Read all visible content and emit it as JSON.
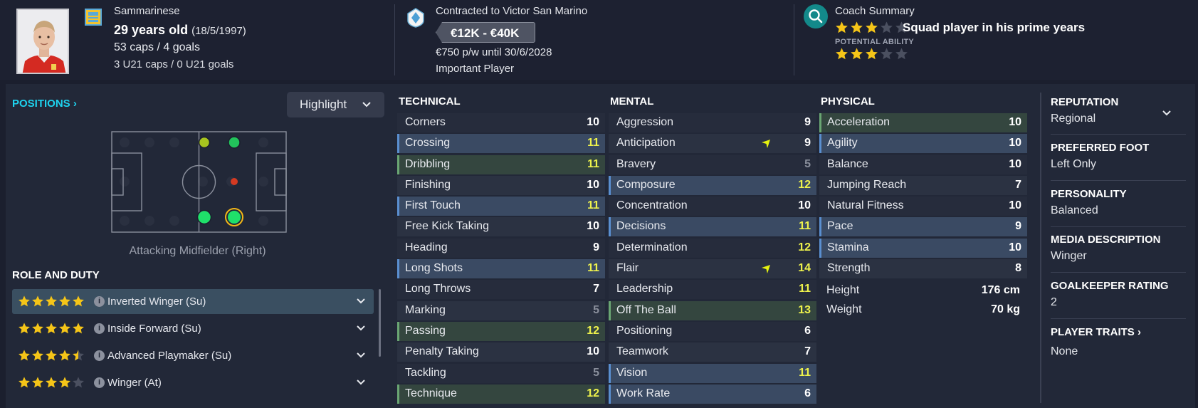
{
  "header": {
    "nationality": "Sammarinese",
    "age": "29 years old",
    "dob": "(18/5/1997)",
    "caps": "53 caps / 4 goals",
    "u21_caps": "3 U21 caps / 0 U21 goals",
    "contract": "Contracted to Victor San Marino",
    "wage_range": "€12K - €40K",
    "wage_detail": "€750 p/w until 30/6/2028",
    "squad_status": "Important Player",
    "coach_title": "Coach Summary",
    "current_ability_stars": 3,
    "coach_description": "Squad player in his prime years",
    "potential_label": "POTENTIAL ABILITY",
    "potential_ability_stars": 3
  },
  "positions": {
    "header": "POSITIONS",
    "highlight_label": "Highlight",
    "position_label": "Attacking Midfielder (Right)",
    "role_header": "ROLE AND DUTY",
    "roles": [
      {
        "name": "Inverted Winger (Su)",
        "stars": 5
      },
      {
        "name": "Inside Forward (Su)",
        "stars": 5
      },
      {
        "name": "Advanced Playmaker (Su)",
        "stars": 4.5
      },
      {
        "name": "Winger (At)",
        "stars": 4
      }
    ]
  },
  "technical": {
    "header": "TECHNICAL",
    "attributes": [
      {
        "name": "Corners",
        "value": "10",
        "hl": ""
      },
      {
        "name": "Crossing",
        "value": "11",
        "hl": "blue"
      },
      {
        "name": "Dribbling",
        "value": "11",
        "hl": "green"
      },
      {
        "name": "Finishing",
        "value": "10",
        "hl": ""
      },
      {
        "name": "First Touch",
        "value": "11",
        "hl": "blue"
      },
      {
        "name": "Free Kick Taking",
        "value": "10",
        "hl": ""
      },
      {
        "name": "Heading",
        "value": "9",
        "hl": ""
      },
      {
        "name": "Long Shots",
        "value": "11",
        "hl": "blue"
      },
      {
        "name": "Long Throws",
        "value": "7",
        "hl": ""
      },
      {
        "name": "Marking",
        "value": "5",
        "hl": ""
      },
      {
        "name": "Passing",
        "value": "12",
        "hl": "green"
      },
      {
        "name": "Penalty Taking",
        "value": "10",
        "hl": ""
      },
      {
        "name": "Tackling",
        "value": "5",
        "hl": ""
      },
      {
        "name": "Technique",
        "value": "12",
        "hl": "green"
      }
    ]
  },
  "mental": {
    "header": "MENTAL",
    "attributes": [
      {
        "name": "Aggression",
        "value": "9",
        "hl": ""
      },
      {
        "name": "Anticipation",
        "value": "9",
        "hl": "",
        "arrow": true
      },
      {
        "name": "Bravery",
        "value": "5",
        "hl": ""
      },
      {
        "name": "Composure",
        "value": "12",
        "hl": "blue"
      },
      {
        "name": "Concentration",
        "value": "10",
        "hl": ""
      },
      {
        "name": "Decisions",
        "value": "11",
        "hl": "blue"
      },
      {
        "name": "Determination",
        "value": "12",
        "hl": ""
      },
      {
        "name": "Flair",
        "value": "14",
        "hl": "",
        "arrow": true
      },
      {
        "name": "Leadership",
        "value": "11",
        "hl": ""
      },
      {
        "name": "Off The Ball",
        "value": "13",
        "hl": "green"
      },
      {
        "name": "Positioning",
        "value": "6",
        "hl": ""
      },
      {
        "name": "Teamwork",
        "value": "7",
        "hl": ""
      },
      {
        "name": "Vision",
        "value": "11",
        "hl": "blue"
      },
      {
        "name": "Work Rate",
        "value": "6",
        "hl": "blue"
      }
    ]
  },
  "physical": {
    "header": "PHYSICAL",
    "attributes": [
      {
        "name": "Acceleration",
        "value": "10",
        "hl": "green"
      },
      {
        "name": "Agility",
        "value": "10",
        "hl": "blue"
      },
      {
        "name": "Balance",
        "value": "10",
        "hl": ""
      },
      {
        "name": "Jumping Reach",
        "value": "7",
        "hl": ""
      },
      {
        "name": "Natural Fitness",
        "value": "10",
        "hl": ""
      },
      {
        "name": "Pace",
        "value": "9",
        "hl": "blue"
      },
      {
        "name": "Stamina",
        "value": "10",
        "hl": "blue"
      },
      {
        "name": "Strength",
        "value": "8",
        "hl": ""
      }
    ],
    "height_label": "Height",
    "height": "176 cm",
    "weight_label": "Weight",
    "weight": "70 kg"
  },
  "info": {
    "reputation_label": "REPUTATION",
    "reputation": "Regional",
    "foot_label": "PREFERRED FOOT",
    "foot": "Left Only",
    "personality_label": "PERSONALITY",
    "personality": "Balanced",
    "media_label": "MEDIA DESCRIPTION",
    "media": "Winger",
    "gk_label": "GOALKEEPER RATING",
    "gk": "2",
    "traits_label": "PLAYER TRAITS",
    "traits": "None"
  },
  "colors": {
    "accent_cyan": "#1ed3ef",
    "star": "#f5c518",
    "value_yellow": "#eef24c",
    "highlight_blue": "#3a4a63",
    "highlight_green": "#34463f"
  }
}
